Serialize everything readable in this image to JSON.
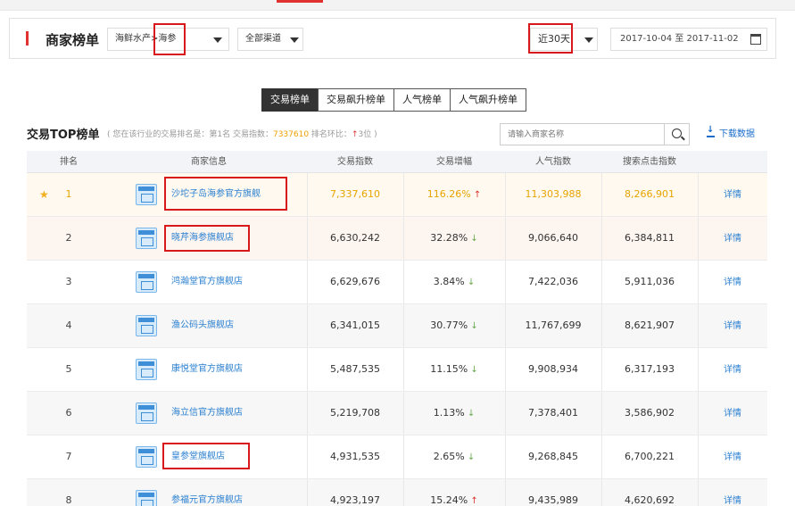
{
  "header": {
    "title": "商家榜单",
    "category_value": "海鲜水产>海参",
    "channel_value": "全部渠道",
    "period_value": "近30天",
    "date_start": "2017-10-04",
    "date_sep": "至",
    "date_end": "2017-11-02"
  },
  "tabs": [
    {
      "label": "交易榜单",
      "active": true
    },
    {
      "label": "交易飙升榜单",
      "active": false
    },
    {
      "label": "人气榜单",
      "active": false
    },
    {
      "label": "人气飙升榜单",
      "active": false
    }
  ],
  "subheader": {
    "title": "交易TOP榜单",
    "note_prefix": "( 您在该行业的交易排名是：第1名  交易指数：",
    "note_index": "7337610",
    "note_mid": "  排名环比：",
    "note_arrow": "↑",
    "note_change": "3位 )",
    "search_placeholder": "请输入商家名称",
    "download_label": "下载数据"
  },
  "table": {
    "columns": [
      "排名",
      "商家信息",
      "交易指数",
      "交易增幅",
      "人气指数",
      "搜索点击指数",
      ""
    ],
    "rows": [
      {
        "rank": "1",
        "shop": "沙坨子岛海参官方旗舰",
        "trade": "7,337,610",
        "growth": "116.26%",
        "dir": "up",
        "popularity": "11,303,988",
        "search": "8,266,901",
        "action": "详情"
      },
      {
        "rank": "2",
        "shop": "晓芹海参旗舰店",
        "trade": "6,630,242",
        "growth": "32.28%",
        "dir": "down",
        "popularity": "9,066,640",
        "search": "6,384,811",
        "action": "详情"
      },
      {
        "rank": "3",
        "shop": "鸿瀚堂官方旗舰店",
        "trade": "6,629,676",
        "growth": "3.84%",
        "dir": "down",
        "popularity": "7,422,036",
        "search": "5,911,036",
        "action": "详情"
      },
      {
        "rank": "4",
        "shop": "渔公码头旗舰店",
        "trade": "6,341,015",
        "growth": "30.77%",
        "dir": "down",
        "popularity": "11,767,699",
        "search": "8,621,907",
        "action": "详情"
      },
      {
        "rank": "5",
        "shop": "康悦堂官方旗舰店",
        "trade": "5,487,535",
        "growth": "11.15%",
        "dir": "down",
        "popularity": "9,908,934",
        "search": "6,317,193",
        "action": "详情"
      },
      {
        "rank": "6",
        "shop": "海立信官方旗舰店",
        "trade": "5,219,708",
        "growth": "1.13%",
        "dir": "down",
        "popularity": "7,378,401",
        "search": "3,586,902",
        "action": "详情"
      },
      {
        "rank": "7",
        "shop": "皇参堂旗舰店",
        "trade": "4,931,535",
        "growth": "2.65%",
        "dir": "down",
        "popularity": "9,268,845",
        "search": "6,700,221",
        "action": "详情"
      },
      {
        "rank": "8",
        "shop": "参福元官方旗舰店",
        "trade": "4,923,197",
        "growth": "15.24%",
        "dir": "up",
        "popularity": "9,435,989",
        "search": "4,620,692",
        "action": "详情"
      }
    ]
  },
  "colors": {
    "accent_red": "#e0322e",
    "link_blue": "#2a7fd0",
    "top_gold": "#e7a400",
    "down_green": "#6aa84f"
  }
}
